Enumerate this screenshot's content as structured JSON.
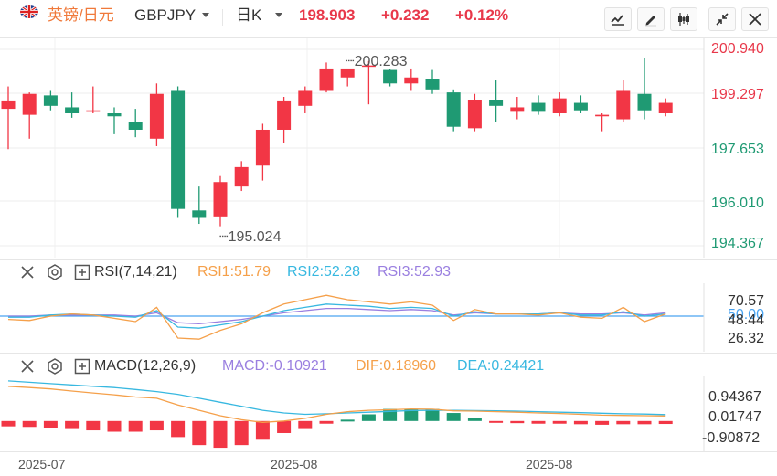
{
  "header": {
    "title_cn": "英镑/日元",
    "symbol": "GBPJPY",
    "timeframe": "日K",
    "price": "198.903",
    "change": "+0.232",
    "change_pct": "+0.12%",
    "icons": [
      "line-chart-icon",
      "pen-icon",
      "candles-icon",
      "collapse-icon",
      "close-icon"
    ]
  },
  "colors": {
    "up": "#f23645",
    "down": "#1f9a73",
    "accent_orange": "#f5a04a",
    "accent_blue": "#38b8e0",
    "accent_purple": "#9a7fe0",
    "zero_line": "#4aa3f0"
  },
  "main_chart": {
    "y_labels": [
      "200.940",
      "199.297",
      "197.653",
      "196.010",
      "194.367"
    ],
    "high_label": "200.283",
    "low_label": "195.024"
  },
  "rsi": {
    "name": "RSI(7,14,21)",
    "rsi1": "RSI1:51.79",
    "rsi2": "RSI2:52.28",
    "rsi3": "RSI3:52.93",
    "y_labels": [
      "70.57",
      "50.00",
      "48.44",
      "26.32"
    ]
  },
  "macd": {
    "name": "MACD(12,26,9)",
    "macd": "MACD:-0.10921",
    "dif": "DIF:0.18960",
    "dea": "DEA:0.24421",
    "y_labels": [
      "0.94367",
      "0.01747",
      "-0.90872"
    ]
  },
  "x_axis": [
    "2025-07",
    "2025-08",
    "2025-08"
  ],
  "chart_data": {
    "type": "candlestick",
    "candles": [
      {
        "o": 198.95,
        "h": 199.7,
        "l": 197.6,
        "c": 199.2
      },
      {
        "o": 198.75,
        "h": 199.5,
        "l": 197.95,
        "c": 199.45
      },
      {
        "o": 199.4,
        "h": 199.55,
        "l": 198.9,
        "c": 199.05
      },
      {
        "o": 199.0,
        "h": 199.5,
        "l": 198.65,
        "c": 198.8
      },
      {
        "o": 198.85,
        "h": 199.7,
        "l": 198.8,
        "c": 198.9
      },
      {
        "o": 198.8,
        "h": 199.0,
        "l": 198.1,
        "c": 198.7
      },
      {
        "o": 198.5,
        "h": 198.95,
        "l": 198.0,
        "c": 198.25
      },
      {
        "o": 197.95,
        "h": 199.8,
        "l": 197.7,
        "c": 199.45
      },
      {
        "o": 199.55,
        "h": 199.7,
        "l": 195.3,
        "c": 195.6
      },
      {
        "o": 195.55,
        "h": 196.35,
        "l": 195.1,
        "c": 195.3
      },
      {
        "o": 195.35,
        "h": 196.7,
        "l": 195.02,
        "c": 196.5
      },
      {
        "o": 196.35,
        "h": 197.2,
        "l": 196.2,
        "c": 197.0
      },
      {
        "o": 197.05,
        "h": 198.45,
        "l": 196.55,
        "c": 198.25
      },
      {
        "o": 198.25,
        "h": 199.35,
        "l": 197.8,
        "c": 199.2
      },
      {
        "o": 199.05,
        "h": 199.7,
        "l": 198.8,
        "c": 199.55
      },
      {
        "o": 199.55,
        "h": 200.5,
        "l": 199.5,
        "c": 200.3
      },
      {
        "o": 200.0,
        "h": 200.28,
        "l": 199.7,
        "c": 200.3
      },
      {
        "o": 200.4,
        "h": 200.55,
        "l": 199.1,
        "c": 200.4
      },
      {
        "o": 200.25,
        "h": 200.28,
        "l": 199.7,
        "c": 199.8
      },
      {
        "o": 199.8,
        "h": 200.3,
        "l": 199.55,
        "c": 200.0
      },
      {
        "o": 199.95,
        "h": 200.25,
        "l": 199.45,
        "c": 199.6
      },
      {
        "o": 199.5,
        "h": 199.6,
        "l": 198.2,
        "c": 198.35
      },
      {
        "o": 198.3,
        "h": 199.45,
        "l": 198.2,
        "c": 199.25
      },
      {
        "o": 199.25,
        "h": 199.9,
        "l": 198.5,
        "c": 199.05
      },
      {
        "o": 198.85,
        "h": 199.35,
        "l": 198.6,
        "c": 199.0
      },
      {
        "o": 199.15,
        "h": 199.4,
        "l": 198.75,
        "c": 198.85
      },
      {
        "o": 198.8,
        "h": 199.5,
        "l": 198.7,
        "c": 199.3
      },
      {
        "o": 199.15,
        "h": 199.4,
        "l": 198.8,
        "c": 198.9
      },
      {
        "o": 198.7,
        "h": 198.8,
        "l": 198.2,
        "c": 198.75
      },
      {
        "o": 198.6,
        "h": 199.9,
        "l": 198.5,
        "c": 199.55
      },
      {
        "o": 199.45,
        "h": 200.65,
        "l": 198.6,
        "c": 198.9
      },
      {
        "o": 198.8,
        "h": 199.3,
        "l": 198.7,
        "c": 199.15
      }
    ],
    "rsi1": [
      47,
      46,
      50,
      52,
      51,
      48,
      45,
      58,
      30,
      29,
      37,
      43,
      53,
      61,
      65,
      69,
      65,
      63,
      61,
      63,
      60,
      46,
      56,
      52,
      52,
      51,
      53,
      49,
      48,
      58,
      45,
      52
    ],
    "rsi2": [
      49,
      49,
      51,
      52,
      51,
      50,
      49,
      55,
      40,
      39,
      42,
      45,
      50,
      55,
      58,
      61,
      60,
      59,
      57,
      58,
      57,
      50,
      54,
      52,
      52,
      52,
      53,
      51,
      51,
      54,
      50,
      52
    ],
    "rsi3": [
      50,
      50,
      51,
      51,
      51,
      51,
      50,
      53,
      44,
      43,
      45,
      47,
      50,
      53,
      55,
      57,
      57,
      56,
      55,
      56,
      55,
      51,
      53,
      52,
      52,
      52,
      53,
      52,
      52,
      53,
      51,
      53
    ],
    "dif": [
      1.3,
      1.25,
      1.2,
      1.12,
      1.05,
      0.98,
      0.9,
      0.85,
      0.6,
      0.4,
      0.2,
      0.05,
      -0.05,
      0.0,
      0.1,
      0.25,
      0.35,
      0.4,
      0.42,
      0.45,
      0.44,
      0.38,
      0.37,
      0.35,
      0.33,
      0.3,
      0.28,
      0.25,
      0.22,
      0.21,
      0.2,
      0.19
    ],
    "dea": [
      1.5,
      1.45,
      1.4,
      1.35,
      1.3,
      1.25,
      1.18,
      1.1,
      1.0,
      0.85,
      0.7,
      0.55,
      0.4,
      0.3,
      0.25,
      0.27,
      0.3,
      0.33,
      0.36,
      0.39,
      0.4,
      0.4,
      0.39,
      0.38,
      0.37,
      0.35,
      0.33,
      0.31,
      0.29,
      0.27,
      0.26,
      0.24
    ],
    "macd": [
      -0.2,
      -0.22,
      -0.26,
      -0.3,
      -0.35,
      -0.4,
      -0.4,
      -0.35,
      -0.6,
      -0.9,
      -1.0,
      -0.9,
      -0.7,
      -0.45,
      -0.3,
      -0.1,
      0.05,
      0.25,
      0.45,
      0.45,
      0.45,
      0.3,
      0.1,
      -0.05,
      -0.08,
      -0.1,
      -0.1,
      -0.12,
      -0.14,
      -0.12,
      -0.12,
      -0.11
    ]
  }
}
